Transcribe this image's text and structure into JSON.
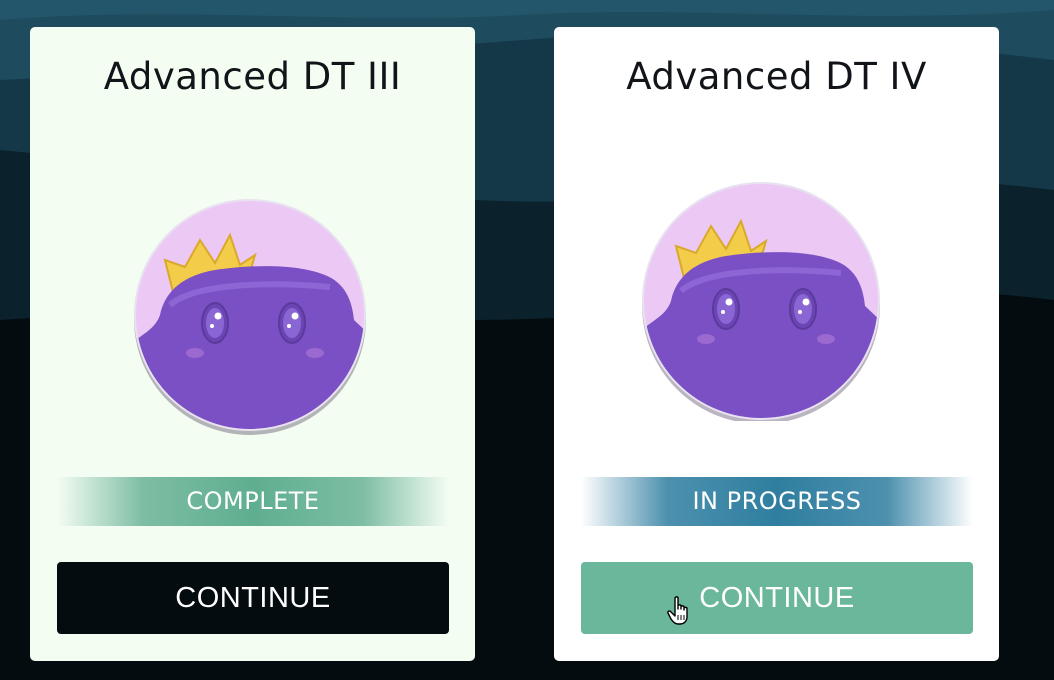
{
  "courses": [
    {
      "title": "Advanced DT III",
      "avatar_icon": "crowned-purple-blob-avatar",
      "status": "COMPLETE",
      "status_color": "#5fae90",
      "button_label": "CONTINUE",
      "button_color": "#050c10"
    },
    {
      "title": "Advanced DT IV",
      "avatar_icon": "crowned-purple-blob-avatar",
      "status": "IN PROGRESS",
      "status_color": "#2f7ea0",
      "button_label": "CONTINUE",
      "button_color": "#6bb79b"
    }
  ],
  "theme": {
    "background_dark": "#050c10",
    "background_wave": "#1d4a5e",
    "avatar_bg": "#ecc9f5",
    "blob": "#7a50c4",
    "crown": "#f3cc4a"
  },
  "cursor_icon": "hand-pointer-icon"
}
